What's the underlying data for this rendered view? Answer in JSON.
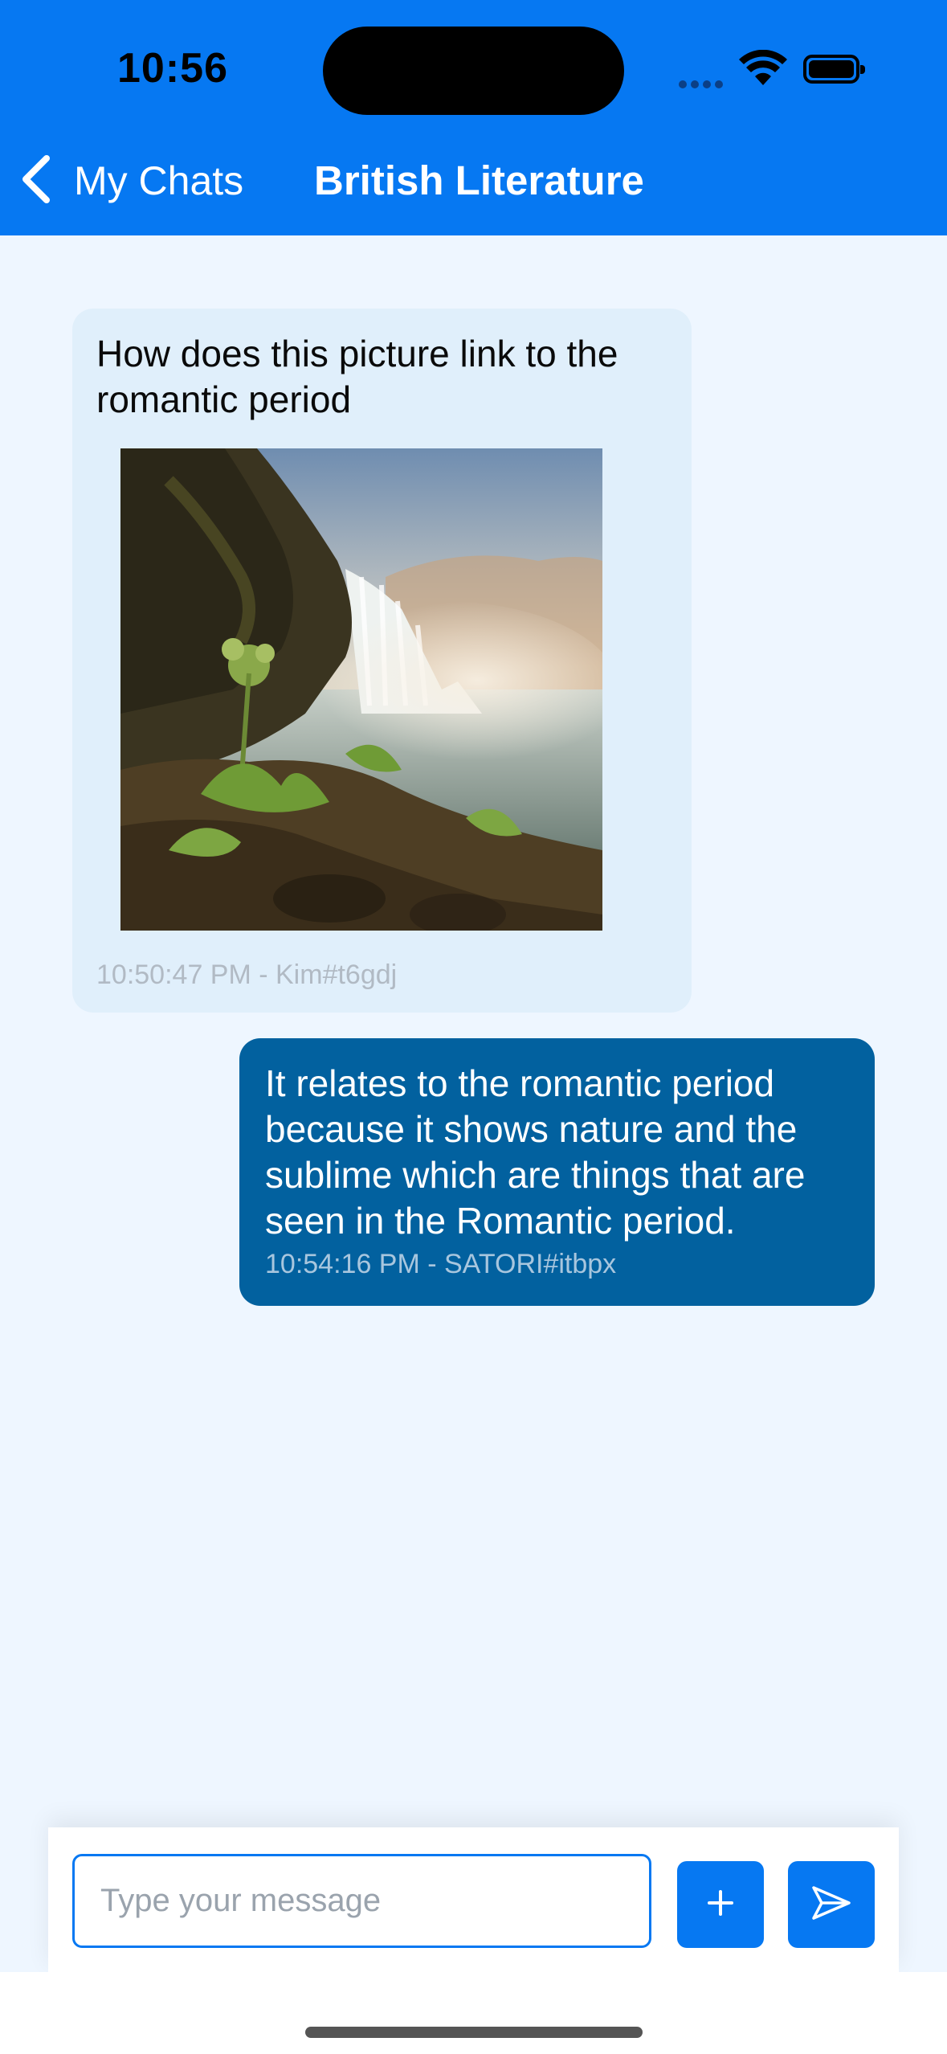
{
  "status_bar": {
    "time": "10:56"
  },
  "header": {
    "back_label": "My Chats",
    "title": "British Literature"
  },
  "messages": [
    {
      "text": "How does this picture link to the romantic period",
      "meta": "10:50:47 PM - Kim#t6gdj",
      "has_image": true
    },
    {
      "text": "It relates to the romantic period because it shows nature and the sublime which are things that are seen in the Romantic period.",
      "meta": "10:54:16 PM - SATORI#itbpx"
    }
  ],
  "composer": {
    "placeholder": "Type your message"
  },
  "colors": {
    "accent": "#0678f2",
    "outgoing_bubble": "#02619f",
    "incoming_bubble": "#e0effb",
    "background": "#eef6ff"
  },
  "icons": {
    "back": "chevron-left-icon",
    "add": "plus-icon",
    "send": "send-icon"
  }
}
